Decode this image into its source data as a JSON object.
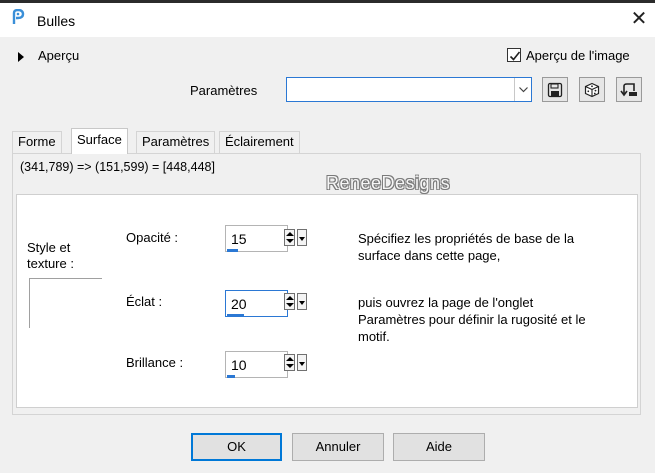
{
  "window": {
    "title": "Bulles",
    "close_label": "✕"
  },
  "preview": {
    "label": "Aperçu"
  },
  "image_preview": {
    "label": "Aperçu de l'image",
    "checked": true
  },
  "presets": {
    "label": "Paramètres",
    "value": ""
  },
  "tabs": [
    {
      "label": "Forme"
    },
    {
      "label": "Surface",
      "active": true
    },
    {
      "label": "Paramètres"
    },
    {
      "label": "Éclairement"
    }
  ],
  "coords": "(341,789) => (151,599) = [448,448]",
  "watermark": "ReneeDesigns",
  "style_texture": {
    "line1": "Style et",
    "line2": "texture :"
  },
  "fields": {
    "opacity": {
      "label": "Opacité :",
      "value": "15"
    },
    "shine": {
      "label": "Éclat :",
      "value": "20"
    },
    "brilliance": {
      "label": "Brillance :",
      "value": "10"
    }
  },
  "help": {
    "para1_line1": "Spécifiez les propriétés de base de la",
    "para1_line2": "surface dans cette page,",
    "para2_line1": "puis ouvrez la page de l'onglet",
    "para2_line2": "Paramètres pour définir la rugosité et le",
    "para2_line3": "motif."
  },
  "buttons": {
    "ok": "OK",
    "cancel": "Annuler",
    "help": "Aide"
  },
  "colors": {
    "accent": "#0078d7",
    "dialog_bg": "#f0f0f0"
  }
}
